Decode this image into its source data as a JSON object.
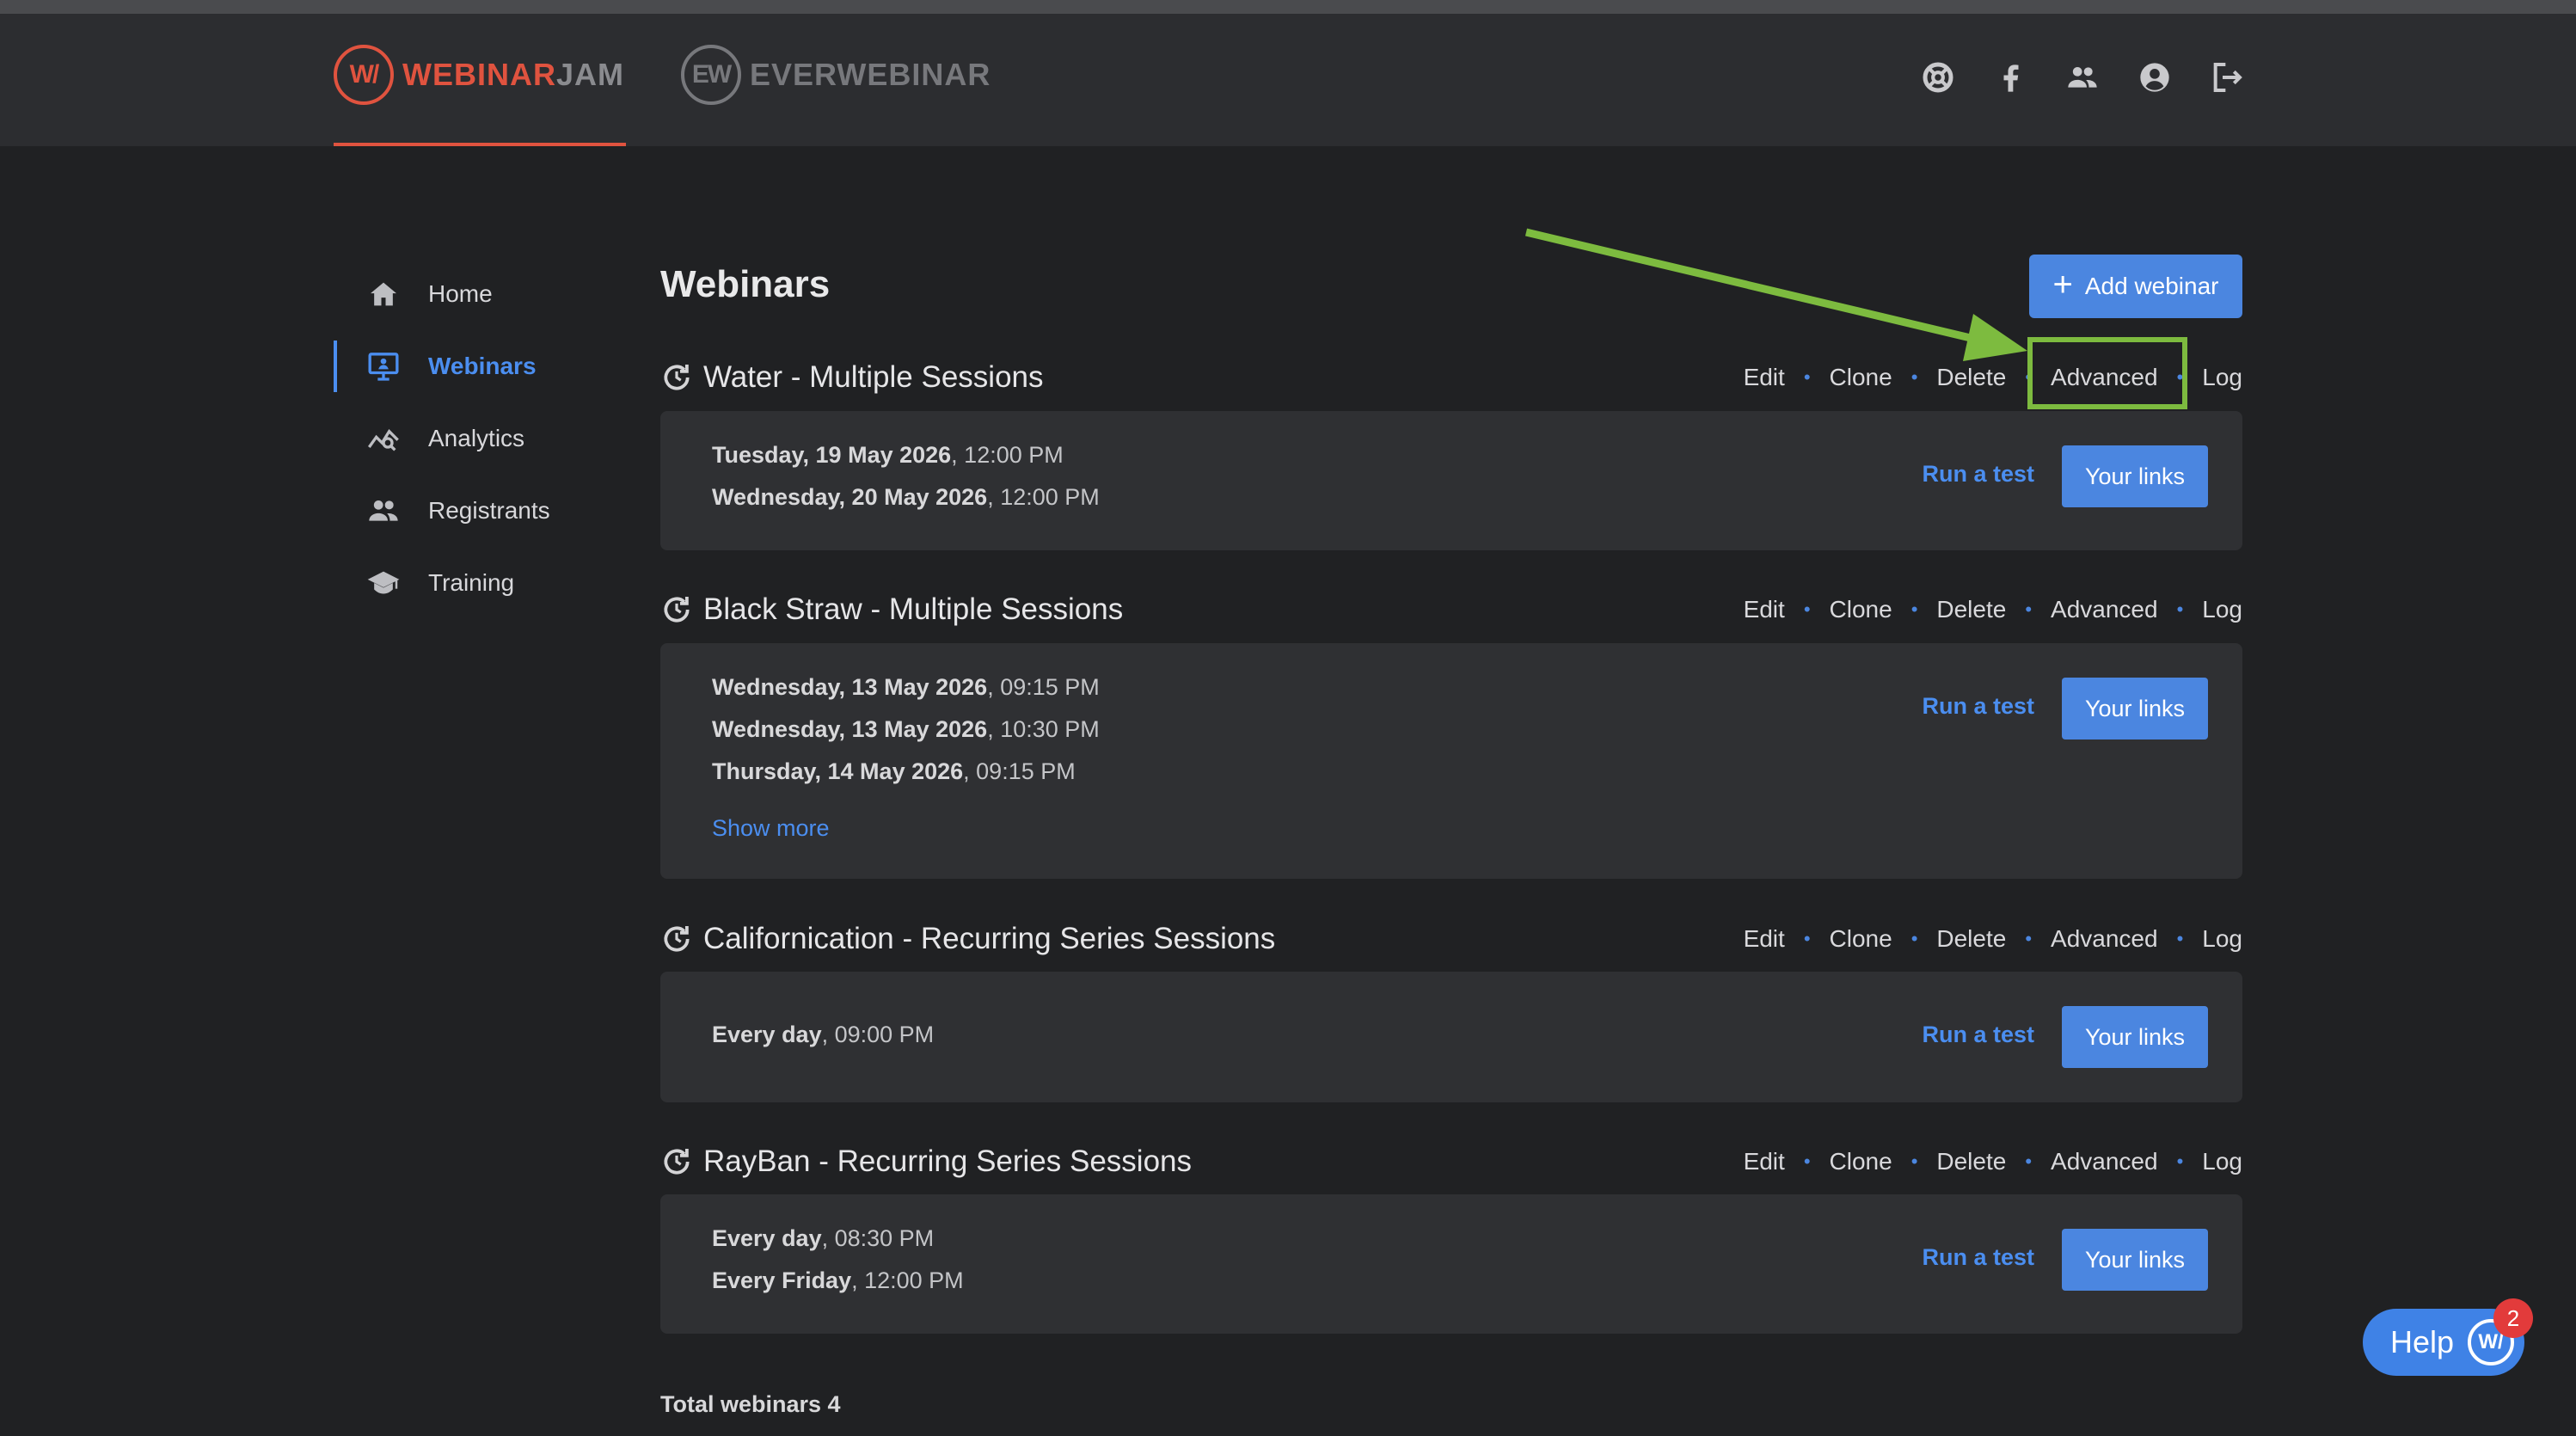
{
  "brand": {
    "webinarjam": {
      "mark": "W/",
      "word_main": "WEBINAR",
      "word_tail": "JAM"
    },
    "everwebinar": {
      "mark": "EW",
      "word": "EVERWEBINAR"
    },
    "accent": "#e0533f"
  },
  "top_icons": [
    "support-icon",
    "facebook-icon",
    "team-icon",
    "account-icon",
    "logout-icon"
  ],
  "sidebar": {
    "items": [
      {
        "label": "Home",
        "icon": "home-icon"
      },
      {
        "label": "Webinars",
        "icon": "webinars-icon",
        "active": true
      },
      {
        "label": "Analytics",
        "icon": "analytics-icon"
      },
      {
        "label": "Registrants",
        "icon": "registrants-icon"
      },
      {
        "label": "Training",
        "icon": "training-icon"
      }
    ]
  },
  "page": {
    "title": "Webinars",
    "add_button": "Add webinar",
    "total": "Total webinars 4"
  },
  "actions": {
    "edit": "Edit",
    "clone": "Clone",
    "delete": "Delete",
    "advanced": "Advanced",
    "log": "Log"
  },
  "buttons": {
    "run_test": "Run a test",
    "your_links": "Your links",
    "show_more": "Show more"
  },
  "webinars": [
    {
      "title": "Water - Multiple Sessions",
      "sessions": [
        {
          "date": "Tuesday, 19 May 2026",
          "time": ", 12:00 PM"
        },
        {
          "date": "Wednesday, 20 May 2026",
          "time": ", 12:00 PM"
        }
      ]
    },
    {
      "title": "Black Straw - Multiple Sessions",
      "sessions": [
        {
          "date": "Wednesday, 13 May 2026",
          "time": ", 09:15 PM"
        },
        {
          "date": "Wednesday, 13 May 2026",
          "time": ", 10:30 PM"
        },
        {
          "date": "Thursday, 14 May 2026",
          "time": ", 09:15 PM"
        }
      ]
    },
    {
      "title": "Californication - Recurring Series Sessions",
      "sessions": [
        {
          "date": "Every day",
          "time": ", 09:00 PM"
        }
      ]
    },
    {
      "title": "RayBan - Recurring Series Sessions",
      "sessions": [
        {
          "date": "Every day",
          "time": ", 08:30 PM"
        },
        {
          "date": "Every Friday",
          "time": ", 12:00 PM"
        }
      ]
    }
  ],
  "help": {
    "label": "Help",
    "mark": "W/",
    "badge": "2"
  },
  "colors": {
    "primary": "#4b86e0",
    "highlight": "#7dbb3f",
    "badge": "#e23b3b"
  }
}
